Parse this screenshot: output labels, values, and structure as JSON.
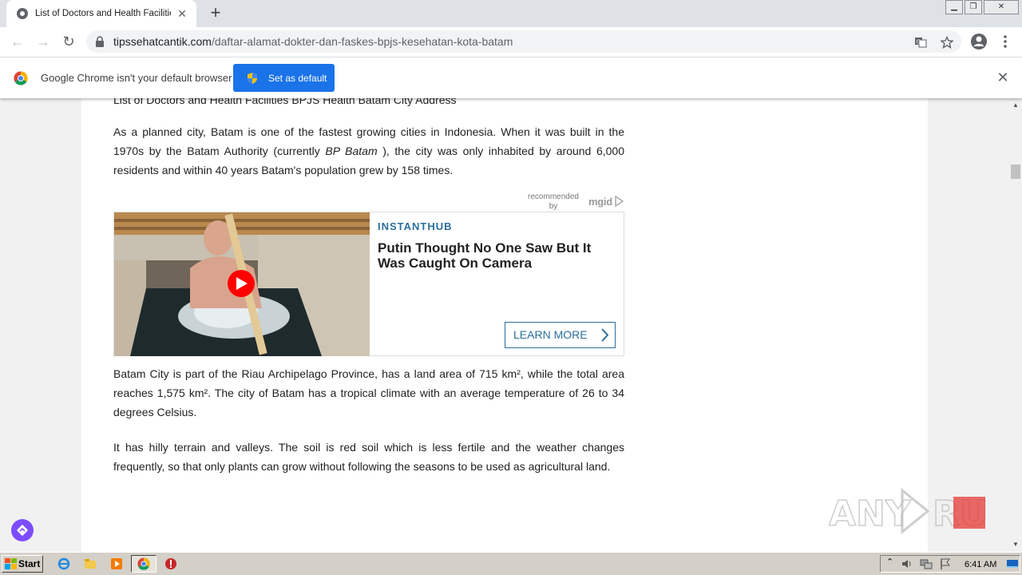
{
  "browser": {
    "tab_title": "List of Doctors and Health Facilities E",
    "url_host": "tipssehatcantik.com",
    "url_path": "/daftar-alamat-dokter-dan-faskes-bpjs-kesehatan-kota-batam"
  },
  "infobar": {
    "message": "Google Chrome isn't your default browser",
    "button_label": "Set as default"
  },
  "article": {
    "cut_line": "List of Doctors and Health Facilities BPJS Health Batam City Address",
    "p1_a": "As a planned city, Batam is one of the fastest growing cities in Indonesia. When it was built in the 1970s by the Batam Authority (currently ",
    "p1_em": "BP Batam",
    "p1_b": " ), the city was only inhabited by around 6,000 residents and within 40 years Batam's population grew by 158 times.",
    "p2": "Batam City is part of the Riau Archipelago Province, has a land area of 715 km², while the total area reaches 1,575 km². The city of Batam has a tropical climate with an average temperature of 26 to 34 degrees Celsius.",
    "p3": "It has hilly terrain and valleys. The soil is red soil which is less fertile and the weather changes frequently, so that only plants can grow without following the seasons to be used as agricultural land."
  },
  "ad": {
    "recommended_by": "recommended by",
    "network": "mgid",
    "brand": "INSTANTHUB",
    "title": "Putin Thought No One Saw But It Was Caught On Camera",
    "cta": "LEARN MORE"
  },
  "watermark": "ANY RUN",
  "taskbar": {
    "start_label": "Start",
    "clock": "6:41 AM"
  },
  "colors": {
    "accent_blue": "#1a73e8",
    "ad_blue": "#2b6f9c",
    "float_button": "#7c4dff"
  }
}
